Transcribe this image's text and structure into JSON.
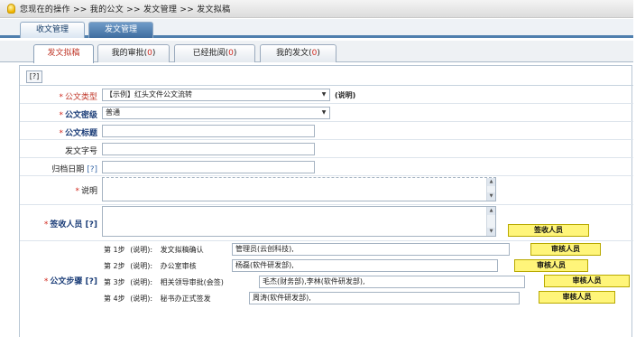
{
  "breadcrumb": "您现在的操作  >> 我的公文  >> 发文管理  >> 发文拟稿",
  "top_tabs": [
    {
      "label": "收文管理"
    },
    {
      "label": "发文管理"
    }
  ],
  "sub_tabs": [
    {
      "label": "发文拟稿",
      "count": ""
    },
    {
      "label": "我的审批(",
      "count": "0",
      "close": ")"
    },
    {
      "label": "已经批阅(",
      "count": "0",
      "close": ")"
    },
    {
      "label": "我的发文(",
      "count": "0",
      "close": ")"
    }
  ],
  "form": {
    "help_label": "[?]",
    "type_label": "公文类型",
    "type_value": "【示例】红头文件公文流转",
    "type_note": "(说明)",
    "secret_label": "公文密级",
    "secret_value": "普通",
    "title_label": "公文标题",
    "docno_label": "发文字号",
    "archive_label": "归档日期",
    "archive_help": "[?]",
    "desc_label": "说明",
    "receivers_label": "签收人员 [?]",
    "receivers_button": "签收人员",
    "steps_label": "公文步骤 [?]",
    "steps": [
      {
        "num": "第 1步",
        "note": "(说明):",
        "name": "发文拟稿确认",
        "value": "管理员(云创科技),",
        "button": "审核人员"
      },
      {
        "num": "第 2步",
        "note": "(说明):",
        "name": "办公室审核",
        "value": "杨磊(软件研发部),",
        "button": "审核人员"
      },
      {
        "num": "第 3步",
        "note": "(说明):",
        "name": "相关领导审批(会签)",
        "value": "毛杰(财务部),李林(软件研发部),",
        "button": "审核人员"
      },
      {
        "num": "第 4步",
        "note": "(说明):",
        "name": "秘书办正式签发",
        "value": "周涛(软件研发部),",
        "button": "审核人员"
      }
    ]
  },
  "colors": {
    "accent_blue": "#4f7fae",
    "required_red": "#d12a1f",
    "button_yellow": "#fff57a"
  }
}
